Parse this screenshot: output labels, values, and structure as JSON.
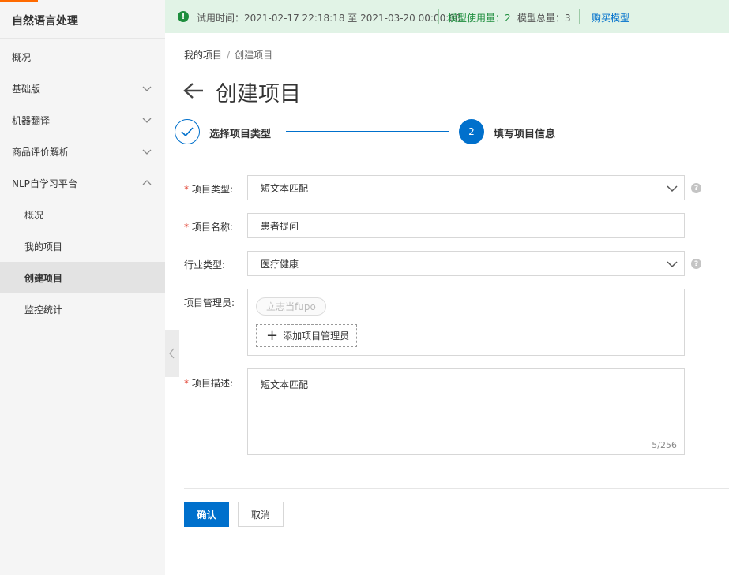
{
  "sidebar": {
    "title": "自然语言处理",
    "items": [
      {
        "label": "概况"
      },
      {
        "label": "基础版"
      },
      {
        "label": "机器翻译"
      },
      {
        "label": "商品评价解析"
      },
      {
        "label": "NLP自学习平台"
      },
      {
        "label": "概况"
      },
      {
        "label": "我的项目"
      },
      {
        "label": "创建项目"
      },
      {
        "label": "监控统计"
      }
    ]
  },
  "banner": {
    "trial_label": "试用时间：",
    "trial_range": "2021-02-17 22:18:18 至 2021-03-20 00:00:00",
    "usage": "模型使用量：2",
    "total": "模型总量：3",
    "buy": "购买模型"
  },
  "breadcrumb": {
    "parent": "我的项目",
    "sep": "/",
    "current": "创建项目"
  },
  "page_title": "创建项目",
  "steps": {
    "step1": "选择项目类型",
    "step2_number": "2",
    "step2": "填写项目信息"
  },
  "form": {
    "type_label": "项目类型:",
    "type_value": "短文本匹配",
    "name_label": "项目名称:",
    "name_value": "患者提问",
    "industry_label": "行业类型:",
    "industry_value": "医疗健康",
    "admin_label": "项目管理员:",
    "admin_tag": "立志当fupo",
    "add_admin": "添加项目管理员",
    "desc_label": "项目描述:",
    "desc_value": "短文本匹配",
    "desc_counter": "5/256",
    "required_mark": "*",
    "help": "?"
  },
  "actions": {
    "confirm": "确认",
    "cancel": "取消"
  },
  "colors": {
    "primary": "#0070cc",
    "accent": "#ff6a00",
    "success": "#1e8e3e",
    "banner_bg": "#e1f3e6"
  }
}
